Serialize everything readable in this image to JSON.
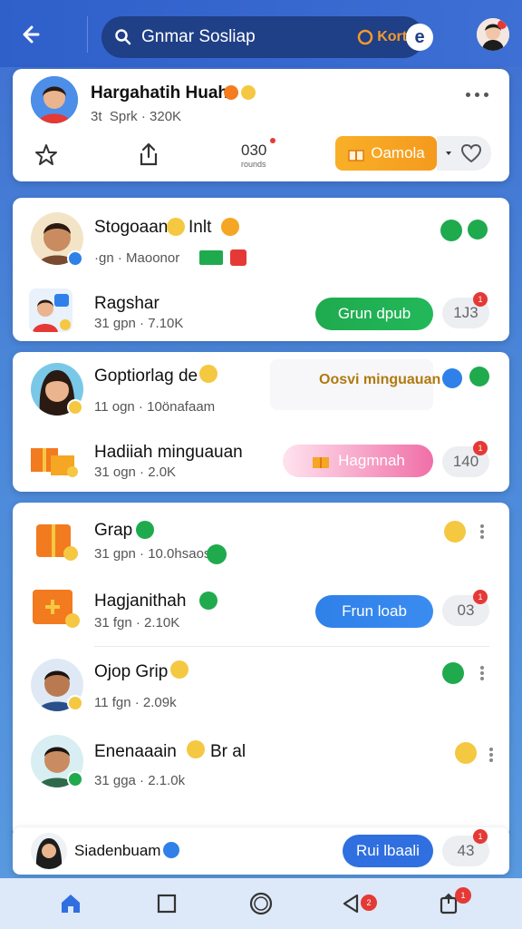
{
  "topbar": {
    "search_query": "Gnmar Sosliap",
    "promo": "Korts",
    "round_badge": "e"
  },
  "profile_card": {
    "name": "Hargahatih Huah",
    "meta": "3t  Sprk · 320K",
    "count_value": "030",
    "count_sub": "rounds",
    "action_label": "Oamola"
  },
  "card2": {
    "row1": {
      "name": "Stogoaan",
      "suffix": "Inlt",
      "meta": "·gn · Maoonor"
    },
    "row2": {
      "name": "Ragshar",
      "meta": "31 gpn · 7.10K",
      "button": "Grun dpub",
      "count": "1J3",
      "badge": "1"
    }
  },
  "card3": {
    "row1": {
      "name": "Goptiorlag de",
      "meta": "11 ogn · 10önafaam",
      "promo": "Oosvi minguauan"
    },
    "row2": {
      "name": "Hadiiah minguauan",
      "meta": "31 ogn · 2.0K",
      "button": "Hagmnah",
      "count": "140",
      "badge": "1"
    }
  },
  "card4": {
    "rows": [
      {
        "name": "Grap",
        "meta": "31 gpn · 10.0hsaos"
      },
      {
        "name": "Hagjanithah",
        "meta": "31 fgn · 2.10K",
        "button": "Frun loab",
        "count": "03",
        "badge": "1"
      },
      {
        "name": "Ojop Grip",
        "meta": "11 fgn · 2.09k"
      },
      {
        "name": "Enenaaain",
        "suffix": "Br al",
        "meta": "31 gga · 2.1.0k"
      }
    ]
  },
  "bottom_bar": {
    "name": "Siadenbuam",
    "button": "Rui lbaali",
    "count": "43",
    "badge": "1"
  },
  "nav": {
    "back_badge": "2",
    "share_badge": "1"
  },
  "colors": {
    "topbar": "#2f5fc9",
    "green": "#1faa4e",
    "blue": "#2f80e8",
    "orange": "#f5a623",
    "pink": "#f06fa8",
    "badge_red": "#e53935"
  }
}
